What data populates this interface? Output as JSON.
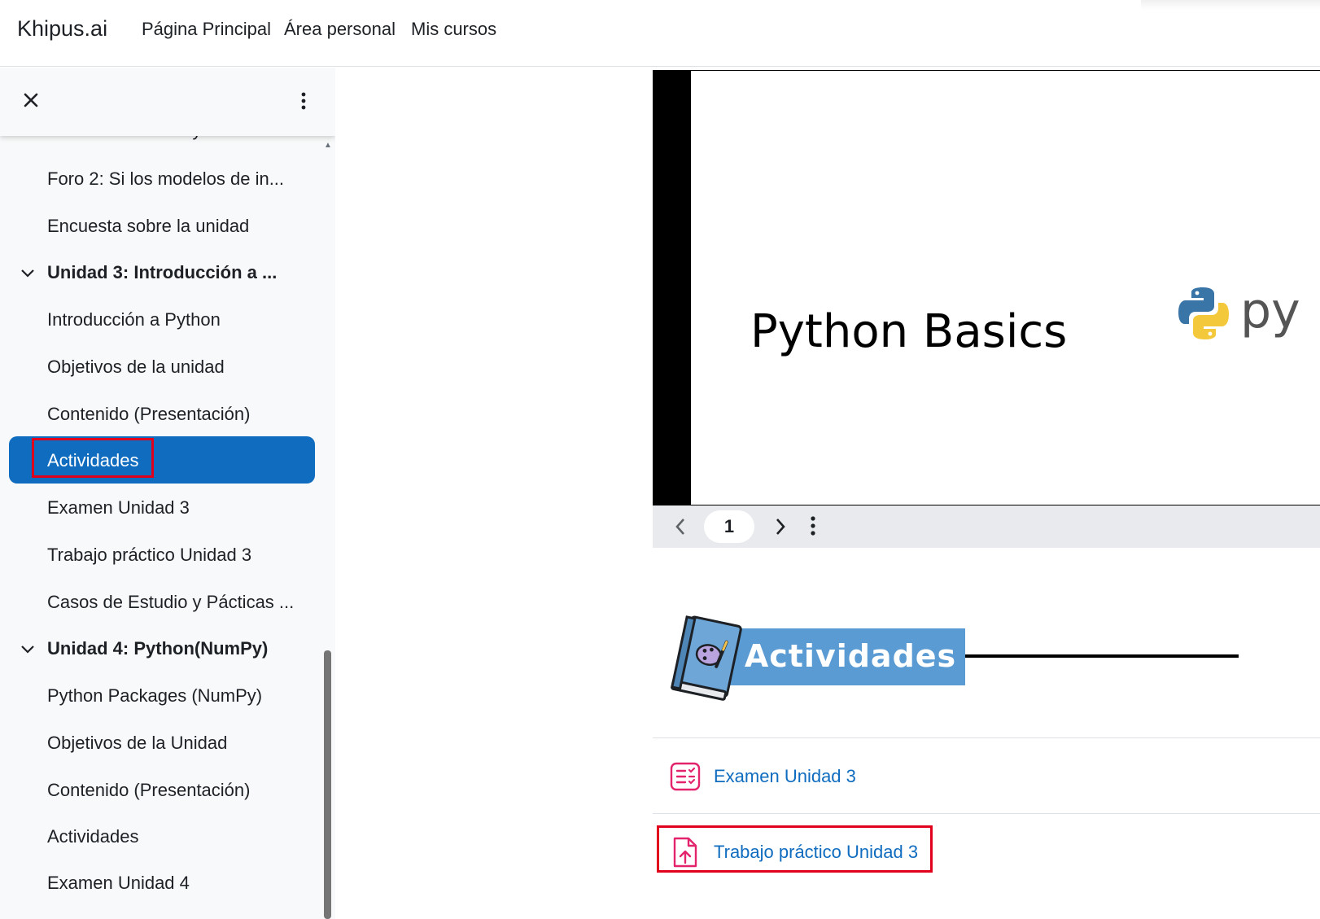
{
  "navbar": {
    "brand": "Khipus.ai",
    "links": [
      "Página Principal",
      "Área personal",
      "Mis cursos"
    ]
  },
  "drawer": {
    "items": {
      "cut_off_top": "Casos de Estudio y Pácticas ...",
      "foro2": "Foro 2: Si los modelos de in...",
      "encuesta": "Encuesta sobre la unidad",
      "unit3": "Unidad 3: Introducción a ...",
      "u3_intro": "Introducción a Python",
      "u3_objetivos": "Objetivos de la unidad",
      "u3_contenido": "Contenido (Presentación)",
      "u3_actividades": "Actividades",
      "u3_examen": "Examen Unidad 3",
      "u3_trabajo": "Trabajo práctico Unidad 3",
      "u3_casos": "Casos de Estudio y Pácticas ...",
      "unit4": "Unidad 4: Python(NumPy)",
      "u4_packages": "Python Packages (NumPy)",
      "u4_objetivos": "Objetivos de la Unidad",
      "u4_contenido": "Contenido (Presentación)",
      "u4_actividades": "Actividades",
      "u4_examen": "Examen Unidad 4"
    }
  },
  "viewer": {
    "slide_title": "Python Basics",
    "logo_text": "py",
    "page_number": "1"
  },
  "banner": {
    "title": "Actividades"
  },
  "activities": {
    "exam": "Examen Unidad 3",
    "assignment": "Trabajo práctico Unidad 3"
  },
  "colors": {
    "primary": "#0f6cbf",
    "highlight": "#e0001b",
    "quiz_icon": "#e3246d",
    "assign_icon": "#e3246d"
  }
}
